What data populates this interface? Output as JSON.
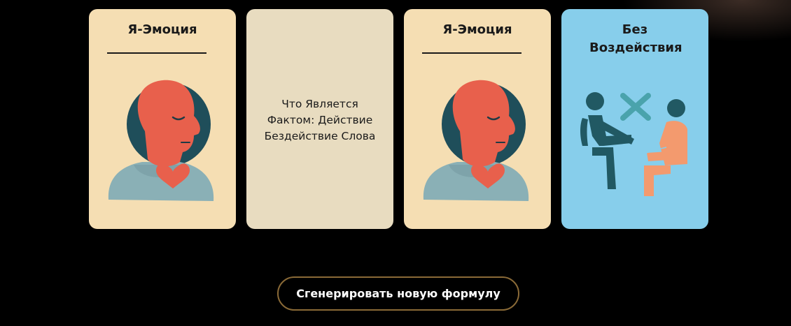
{
  "cards": [
    {
      "title": "Я-Эмоция",
      "icon": "person-heart-icon",
      "background": "#f5deb3"
    },
    {
      "text": "Что Является Фактом: Действие Бездействие Слова",
      "background": "#e8dcc0"
    },
    {
      "title": "Я-Эмоция",
      "icon": "person-heart-icon",
      "background": "#f5deb3"
    },
    {
      "title": "Без Воздействия",
      "icon": "no-contact-icon",
      "background": "#87ceeb"
    }
  ],
  "generate_button": {
    "label": "Сгенерировать новую формулу"
  },
  "colors": {
    "page_background": "#000000",
    "button_border": "#8a6a37",
    "head_red": "#e8604c",
    "head_shadow": "#1f4e5a",
    "shoulders": "#8ab0b6",
    "figure_dark": "#215963",
    "figure_orange": "#f39a6e",
    "cross_teal": "#4aa3ac"
  }
}
